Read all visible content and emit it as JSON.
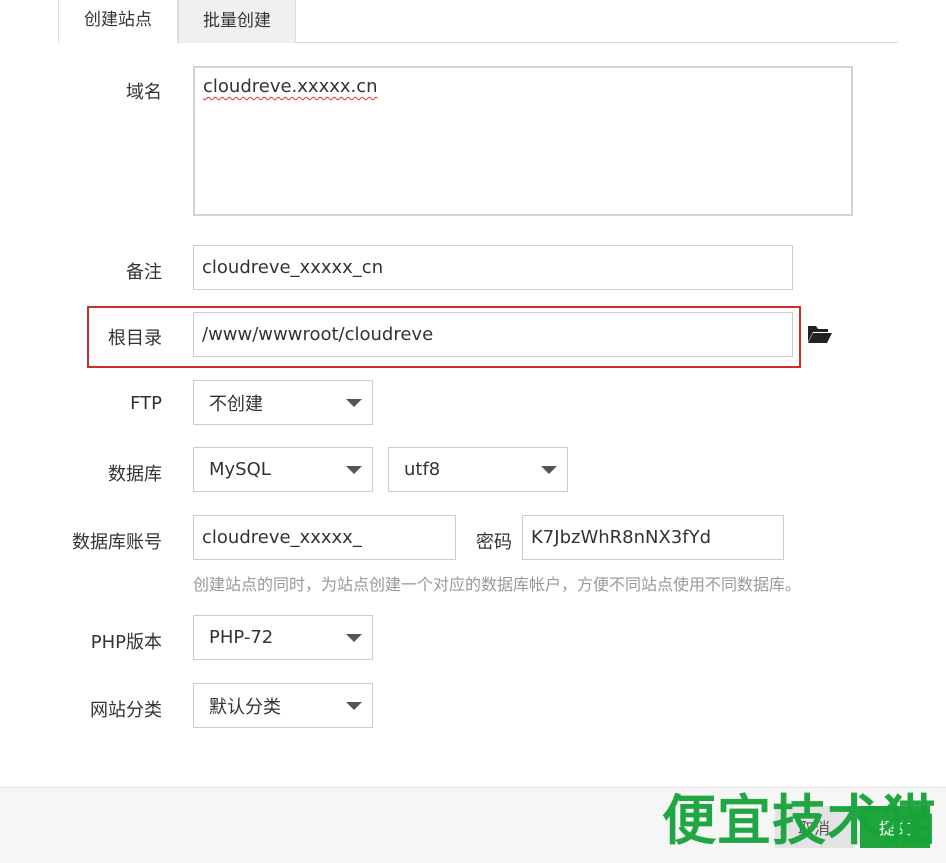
{
  "tabs": [
    {
      "label": "创建站点",
      "active": true
    },
    {
      "label": "批量创建",
      "active": false
    }
  ],
  "form": {
    "domain": {
      "label": "域名",
      "value": "cloudreve.xxxxx.cn"
    },
    "remark": {
      "label": "备注",
      "value": "cloudreve_xxxxx_cn"
    },
    "root_dir": {
      "label": "根目录",
      "value": "/www/wwwroot/cloudreve",
      "icon": "folder-open-icon"
    },
    "ftp": {
      "label": "FTP",
      "selected": "不创建"
    },
    "database": {
      "label": "数据库",
      "type_selected": "MySQL",
      "charset_selected": "utf8"
    },
    "db_account": {
      "label": "数据库账号",
      "username": "cloudreve_xxxxx_",
      "password_label": "密码",
      "password": "K7JbzWhR8nNX3fYd",
      "hint": "创建站点的同时，为站点创建一个对应的数据库帐户，方便不同站点使用不同数据库。"
    },
    "php": {
      "label": "PHP版本",
      "selected": "PHP-72"
    },
    "category": {
      "label": "网站分类",
      "selected": "默认分类"
    }
  },
  "footer": {
    "cancel_label": "取消",
    "submit_label": "提交"
  },
  "watermark": "便宜技术猫",
  "colors": {
    "accent_green": "#20a53a",
    "highlight_red": "#c9302c"
  }
}
